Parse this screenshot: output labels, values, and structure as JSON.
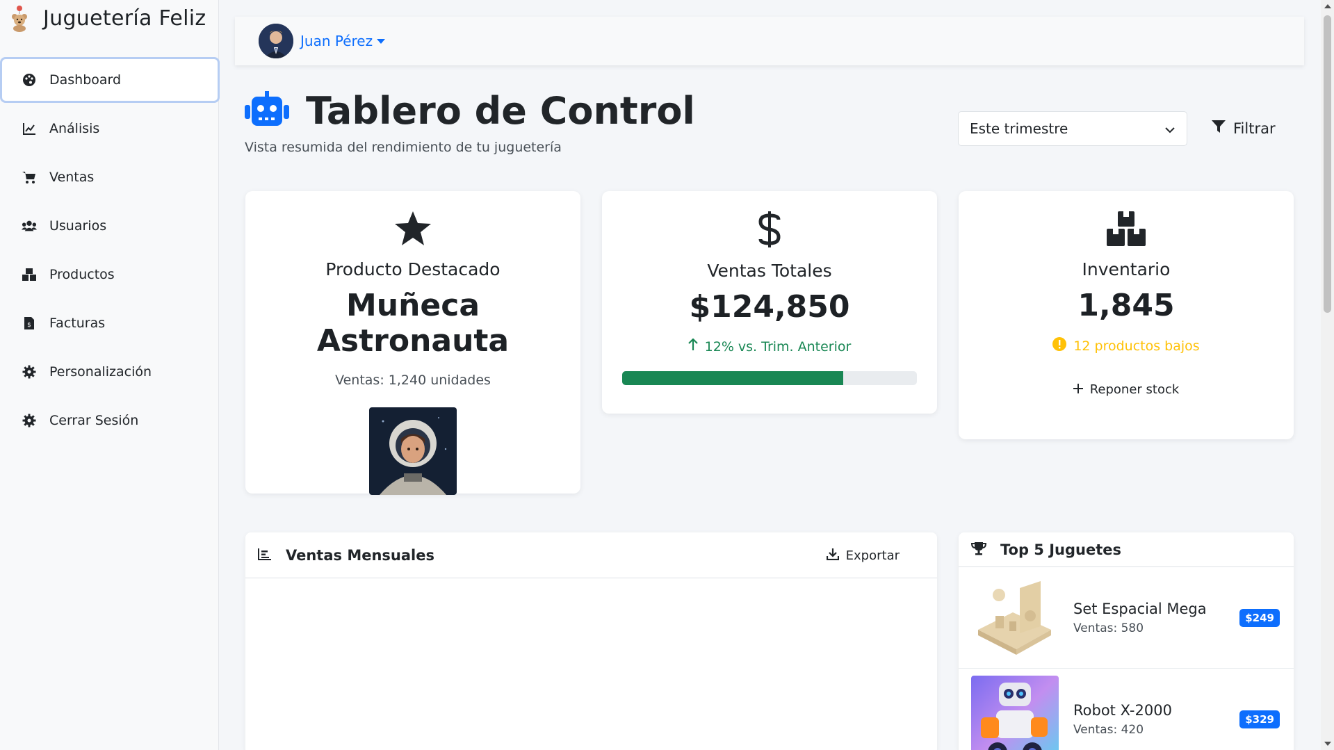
{
  "app": {
    "name": "Juguetería Feliz"
  },
  "sidebar": {
    "items": [
      {
        "label": "Dashboard",
        "icon": "palette-icon",
        "active": true
      },
      {
        "label": "Análisis",
        "icon": "line-chart-icon"
      },
      {
        "label": "Ventas",
        "icon": "cart-icon"
      },
      {
        "label": "Usuarios",
        "icon": "users-icon"
      },
      {
        "label": "Productos",
        "icon": "boxes-icon"
      },
      {
        "label": "Facturas",
        "icon": "invoice-icon"
      },
      {
        "label": "Personalización",
        "icon": "gear-icon"
      },
      {
        "label": "Cerrar Sesión",
        "icon": "gear-icon"
      }
    ]
  },
  "topbar": {
    "user_name": "Juan Pérez"
  },
  "header": {
    "title": "Tablero de Control",
    "subtitle": "Vista resumida del rendimiento de tu juguetería",
    "period_selected": "Este trimestre",
    "filter_label": "Filtrar"
  },
  "cards": {
    "featured": {
      "label": "Producto Destacado",
      "value": "Muñeca Astronauta",
      "note": "Ventas: 1,240 unidades"
    },
    "sales": {
      "label": "Ventas Totales",
      "value": "$124,850",
      "note": "12% vs. Trim. Anterior",
      "progress": 0.75
    },
    "inventory": {
      "label": "Inventario",
      "value": "1,845",
      "warning": "12 productos bajos",
      "action": "Reponer stock"
    }
  },
  "monthly_sales": {
    "title": "Ventas Mensuales",
    "export_label": "Exportar"
  },
  "top_toys": {
    "title": "Top 5 Juguetes",
    "items": [
      {
        "name": "Set Espacial Mega",
        "sales": "Ventas: 580",
        "price": "$249"
      },
      {
        "name": "Robot X-2000",
        "sales": "Ventas: 420",
        "price": "$329"
      }
    ]
  },
  "colors": {
    "primary": "#0d6efd",
    "success": "#198754",
    "warning": "#ffc107"
  }
}
